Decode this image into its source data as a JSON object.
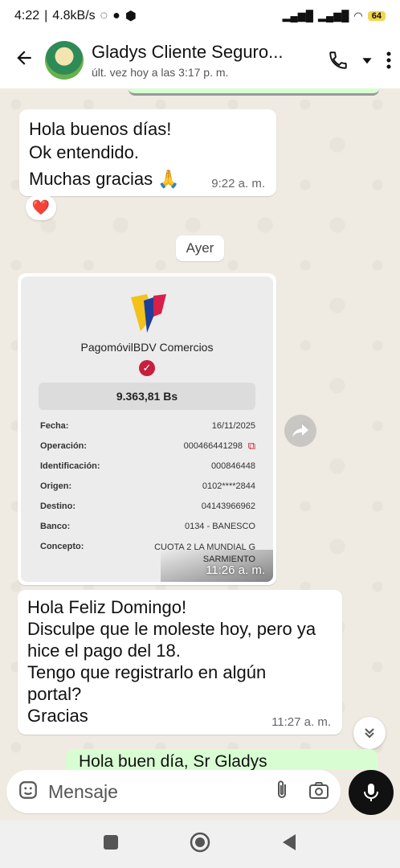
{
  "status_bar": {
    "time": "4:22",
    "speed": "4.8kB/s",
    "battery": "64"
  },
  "header": {
    "back_icon": "arrow-left",
    "contact_name": "Gladys Cliente Seguro...",
    "last_seen": "últ. vez hoy a las 3:17 p. m."
  },
  "messages": {
    "first": {
      "lines": [
        "Hola buenos días!",
        "Ok entendido.",
        "Muchas gracias 🙏"
      ],
      "time": "9:22 a. m.",
      "reaction": "❤️"
    },
    "day_separator": "Ayer",
    "receipt": {
      "brand": "PagomóvilBDV Comercios",
      "amount": "9.363,81 Bs",
      "rows": [
        {
          "key": "Fecha:",
          "value": "16/11/2025"
        },
        {
          "key": "Operación:",
          "value": "000466441298"
        },
        {
          "key": "Identificación:",
          "value": "000846448"
        },
        {
          "key": "Origen:",
          "value": "0102****2844"
        },
        {
          "key": "Destino:",
          "value": "04143966962"
        },
        {
          "key": "Banco:",
          "value": "0134 - BANESCO"
        },
        {
          "key": "Concepto:",
          "value": "CUOTA 2 LA MUNDIAL G SARMIENTO"
        }
      ],
      "time": "11:26 a. m."
    },
    "second": {
      "lines": [
        "Hola Feliz Domingo!",
        "Disculpe que le moleste hoy, pero ya",
        "hice el pago del 18.",
        "Tengo que registrarlo en algún",
        "portal?",
        "Gracias"
      ],
      "time": "11:27 a. m."
    },
    "partial_outgoing": "Hola buen día, Sr Gladys"
  },
  "composer": {
    "placeholder": "Mensaje"
  },
  "colors": {
    "outgoing": "#d9fdd3",
    "chat_bg": "#efeae2",
    "accent_red": "#c6203e"
  }
}
